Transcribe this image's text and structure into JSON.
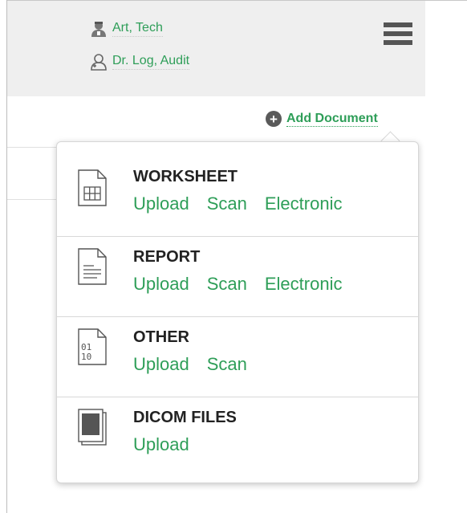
{
  "header": {
    "people": [
      {
        "icon": "technician-icon",
        "name": "Art, Tech"
      },
      {
        "icon": "doctor-icon",
        "name": "Dr. Log, Audit"
      }
    ],
    "menu_icon": "hamburger-menu-icon"
  },
  "add_document": {
    "icon": "plus-circle-icon",
    "label": "Add Document"
  },
  "doc_types": [
    {
      "title": "WORKSHEET",
      "icon": "worksheet-grid-icon",
      "actions": [
        "Upload",
        "Scan",
        "Electronic"
      ]
    },
    {
      "title": "REPORT",
      "icon": "report-lines-icon",
      "actions": [
        "Upload",
        "Scan",
        "Electronic"
      ]
    },
    {
      "title": "OTHER",
      "icon": "binary-file-icon",
      "actions": [
        "Upload",
        "Scan"
      ]
    },
    {
      "title": "DICOM FILES",
      "icon": "dicom-image-icon",
      "actions": [
        "Upload"
      ]
    }
  ],
  "colors": {
    "accent": "#2e9e58",
    "icon_gray": "#555555",
    "panel_bg": "#efefef"
  }
}
